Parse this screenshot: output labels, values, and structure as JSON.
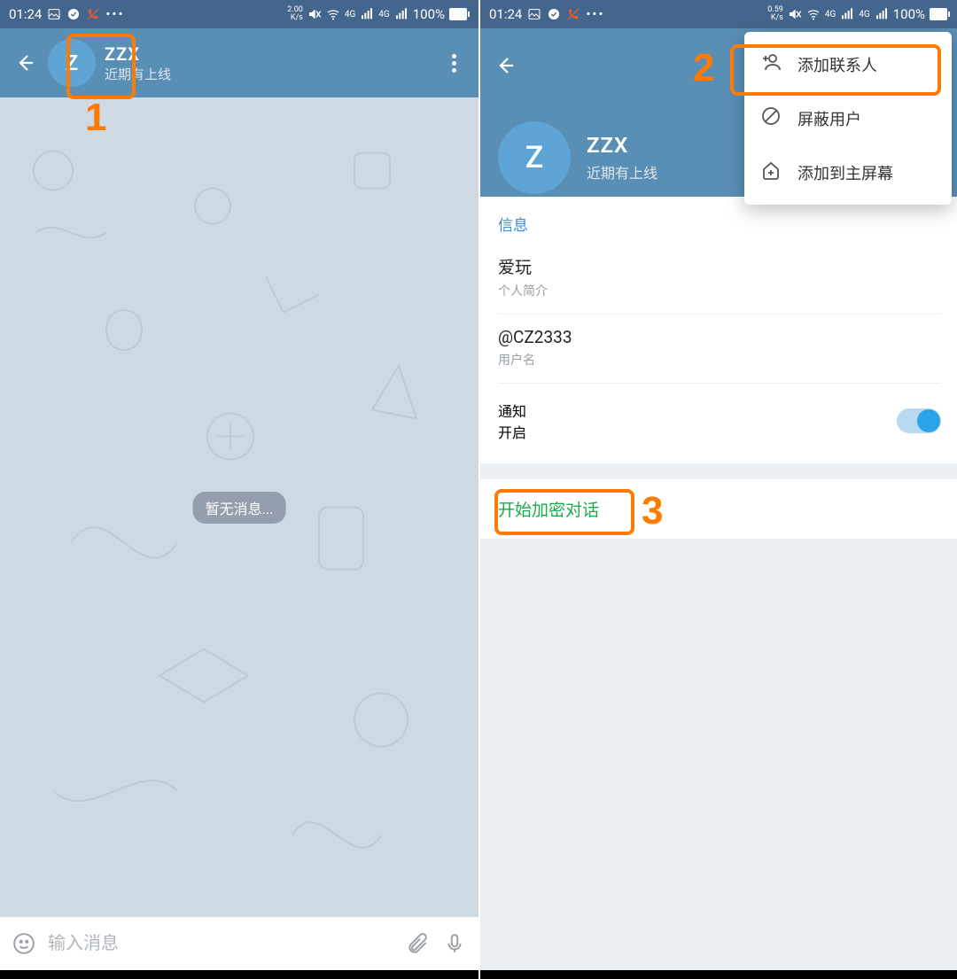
{
  "statusbar": {
    "time": "01:24",
    "speed_left": "2.00",
    "speed_right": "0.59",
    "unit": "K/s",
    "net": "4G",
    "battery": "100%"
  },
  "chat": {
    "avatar_letter": "Z",
    "name": "ZZX",
    "status": "近期有上线",
    "no_messages": "暂无消息...",
    "input_placeholder": "输入消息"
  },
  "profile": {
    "avatar_letter": "Z",
    "name": "ZZX",
    "status": "近期有上线",
    "section_info": "信息",
    "bio_value": "爱玩",
    "bio_label": "个人简介",
    "username_value": "@CZ2333",
    "username_label": "用户名",
    "notif_title": "通知",
    "notif_state": "开启",
    "start_secret": "开始加密对话"
  },
  "menu": {
    "add_contact": "添加联系人",
    "block_user": "屏蔽用户",
    "add_home": "添加到主屏幕"
  },
  "annot": {
    "n1": "1",
    "n2": "2",
    "n3": "3"
  }
}
